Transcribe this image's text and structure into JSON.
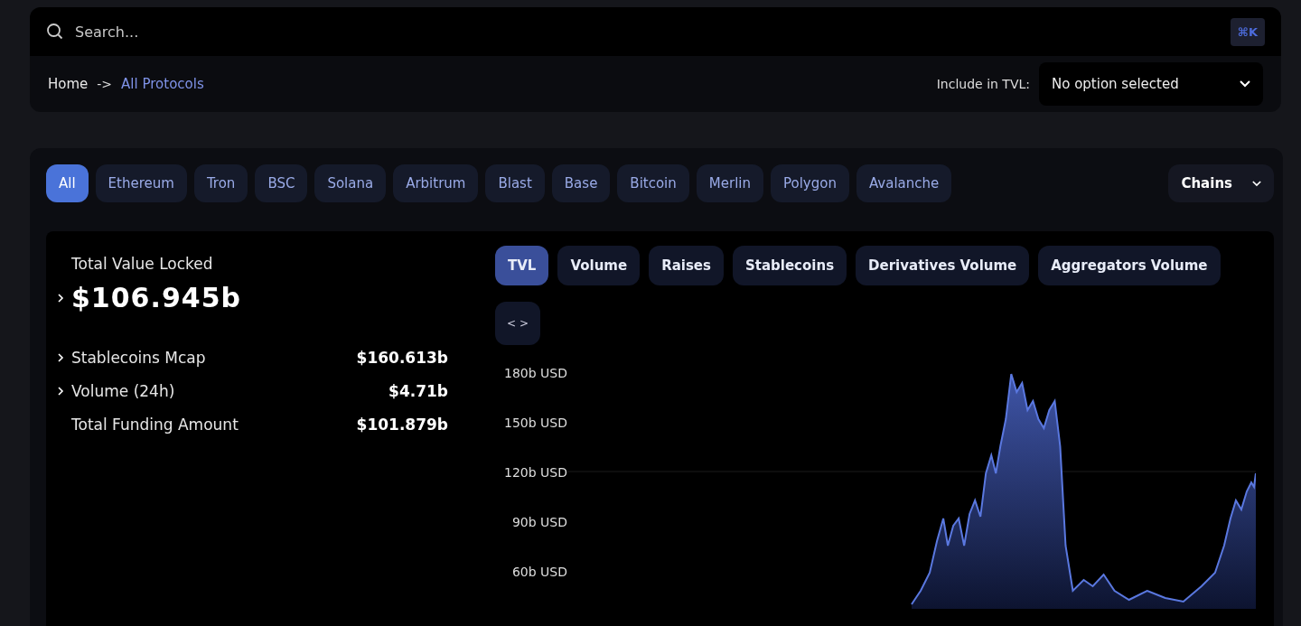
{
  "search": {
    "placeholder": "Search...",
    "shortcut": "⌘K"
  },
  "breadcrumb": {
    "items": [
      "Home",
      "All Protocols"
    ],
    "separator": "->"
  },
  "tvl_filter": {
    "label": "Include in TVL:",
    "value": "No option selected"
  },
  "chains": [
    {
      "label": "All",
      "selected": true
    },
    {
      "label": "Ethereum",
      "selected": false
    },
    {
      "label": "Tron",
      "selected": false
    },
    {
      "label": "BSC",
      "selected": false
    },
    {
      "label": "Solana",
      "selected": false
    },
    {
      "label": "Arbitrum",
      "selected": false
    },
    {
      "label": "Blast",
      "selected": false
    },
    {
      "label": "Base",
      "selected": false
    },
    {
      "label": "Bitcoin",
      "selected": false
    },
    {
      "label": "Merlin",
      "selected": false
    },
    {
      "label": "Polygon",
      "selected": false
    },
    {
      "label": "Avalanche",
      "selected": false
    }
  ],
  "chains_dropdown": {
    "label": "Chains"
  },
  "summary": {
    "title": "Total Value Locked",
    "value": "$106.945b",
    "expandable": true,
    "metrics": [
      {
        "label": "Stablecoins Mcap",
        "value": "$160.613b",
        "expandable": true
      },
      {
        "label": "Volume (24h)",
        "value": "$4.71b",
        "expandable": true
      },
      {
        "label": "Total Funding Amount",
        "value": "$101.879b",
        "expandable": false
      }
    ]
  },
  "chart_tabs": [
    {
      "label": "TVL",
      "selected": true
    },
    {
      "label": "Volume",
      "selected": false
    },
    {
      "label": "Raises",
      "selected": false
    },
    {
      "label": "Stablecoins",
      "selected": false
    },
    {
      "label": "Derivatives Volume",
      "selected": false
    },
    {
      "label": "Aggregators Volume",
      "selected": false
    }
  ],
  "embed_button": {
    "label": "< >"
  },
  "chart": {
    "y_ticks": [
      "180b USD",
      "150b USD",
      "120b USD",
      "90b USD",
      "60b USD"
    ]
  }
}
